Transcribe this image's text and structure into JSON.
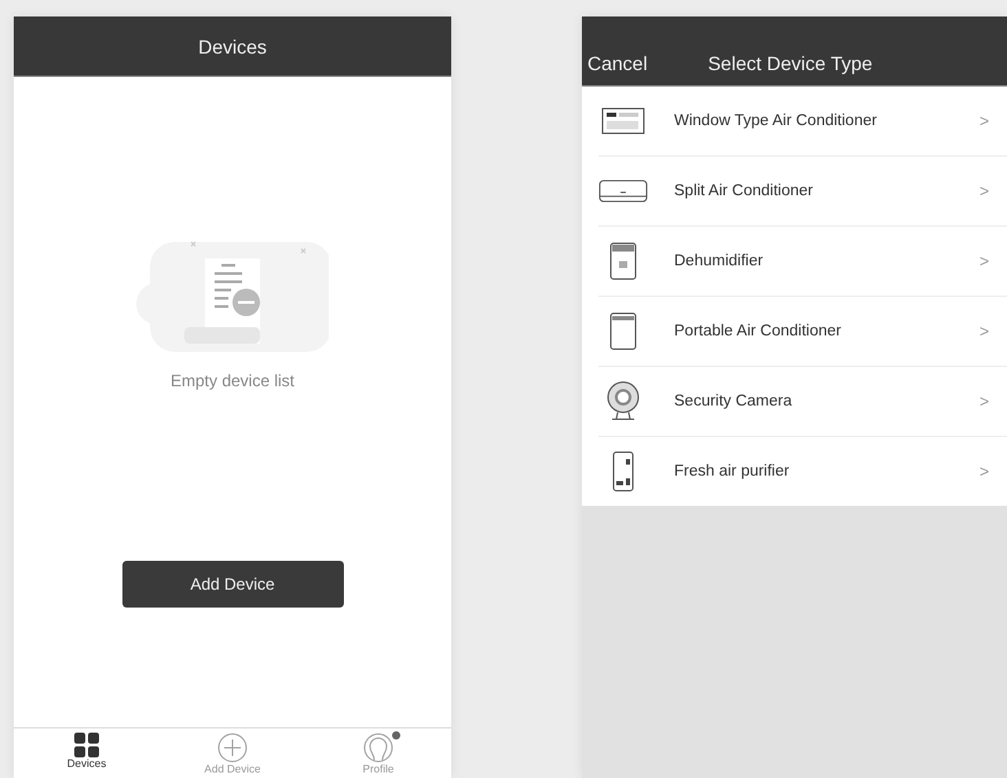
{
  "devices_screen": {
    "title": "Devices",
    "empty_message": "Empty device list",
    "add_button": "Add Device",
    "tabs": [
      {
        "label": "Devices",
        "selected": true,
        "dot": false
      },
      {
        "label": "Add Device",
        "selected": false,
        "dot": false
      },
      {
        "label": "Profile",
        "selected": false,
        "dot": true
      }
    ]
  },
  "select_screen": {
    "cancel": "Cancel",
    "title": "Select Device Type",
    "items": [
      {
        "label": "Window Type Air Conditioner",
        "chevron": ">"
      },
      {
        "label": "Split Air Conditioner",
        "chevron": ">"
      },
      {
        "label": "Dehumidifier",
        "chevron": ">"
      },
      {
        "label": "Portable Air Conditioner",
        "chevron": ">"
      },
      {
        "label": "Security Camera",
        "chevron": ">"
      },
      {
        "label": "Fresh air purifier",
        "chevron": ">"
      }
    ]
  }
}
